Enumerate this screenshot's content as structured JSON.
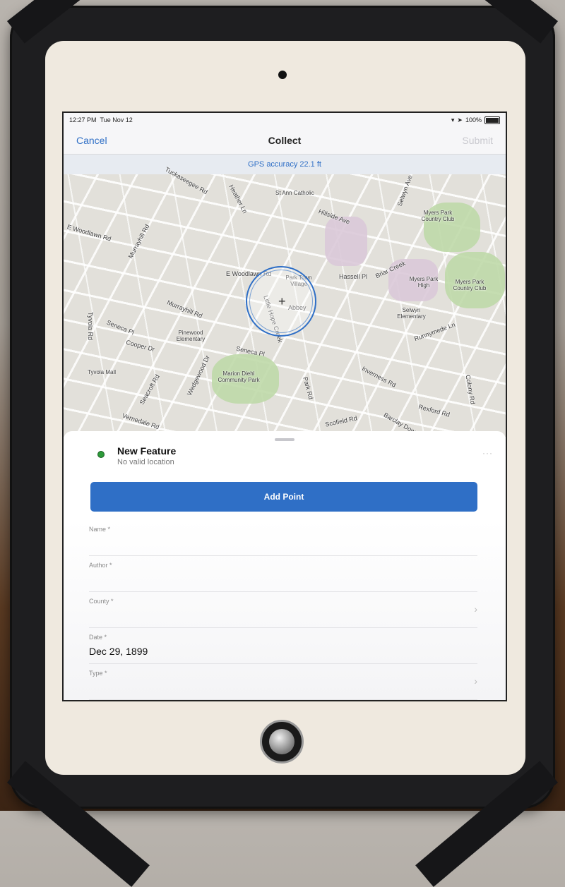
{
  "status_bar": {
    "time": "12:27 PM",
    "date": "Tue Nov 12",
    "battery": "100%"
  },
  "nav": {
    "cancel_label": "Cancel",
    "title": "Collect",
    "submit_label": "Submit"
  },
  "gps_accuracy": "GPS accuracy 22.1 ft",
  "map": {
    "labels": [
      "Tuckaseegee Rd",
      "Heather Ln",
      "St Ann Catholic",
      "Hillside Ave",
      "Selwyn Ave",
      "Myers Park Country Club",
      "E Woodlawn Rd",
      "Murrayhill Rd",
      "E Woodlawn Rd",
      "Park Town Village",
      "Abbey",
      "Little Hope Creek",
      "Hassell Pl",
      "Briar Creek",
      "Myers Park High",
      "Myers Park Country Club",
      "Selwyn Elementary",
      "Runnymede Ln",
      "Murrayhill Rd",
      "Seneca Pl",
      "Pinewood Elementary",
      "Cooper Dr",
      "Seneca Pl",
      "Tyvola Mall",
      "Seacroft Rd",
      "Wedgewood Dr",
      "Marion Diehl Community Park",
      "Park Rd",
      "Inverness Rd",
      "Colony Rd",
      "Rexford Rd",
      "Scofield Rd",
      "Barclay Downs",
      "Vernedale Rd",
      "Tyvola Rd"
    ]
  },
  "sheet": {
    "feature_title": "New Feature",
    "feature_subtitle": "No valid location",
    "more_label": "···",
    "add_point_label": "Add Point",
    "fields": [
      {
        "label": "Name *",
        "value": ""
      },
      {
        "label": "Author *",
        "value": ""
      },
      {
        "label": "County *",
        "value": "",
        "chevron": true
      },
      {
        "label": "Date *",
        "value": "Dec 29, 1899"
      },
      {
        "label": "Type *",
        "value": "",
        "chevron": true
      }
    ]
  },
  "colors": {
    "accent": "#2f6fc6",
    "feature_dot": "#2d9b3a"
  }
}
